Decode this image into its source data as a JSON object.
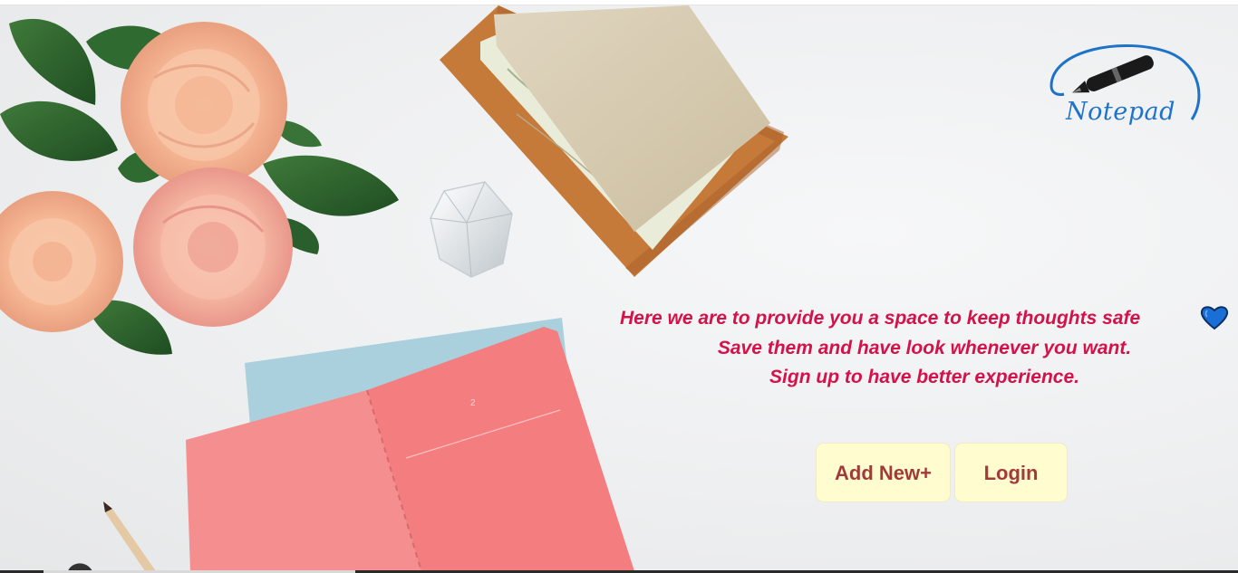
{
  "app": {
    "logo_text": "Notepad"
  },
  "hero": {
    "tagline_lines": [
      "Here we are to provide you a space to keep thoughts safe",
      "Save them and have look whenever you want.",
      "Sign up to have better experience."
    ],
    "notebook_page_number": "2"
  },
  "actions": {
    "add_new_label": "Add New+",
    "login_label": "Login"
  },
  "icons": {
    "logo": "pen-icon",
    "heart": "heart-icon"
  },
  "colors": {
    "tagline": "#d3124a",
    "button_bg": "#fffdd0",
    "button_text": "#a33a3a",
    "logo_blue": "#1e73c8",
    "heart_blue": "#1a6fd6"
  }
}
